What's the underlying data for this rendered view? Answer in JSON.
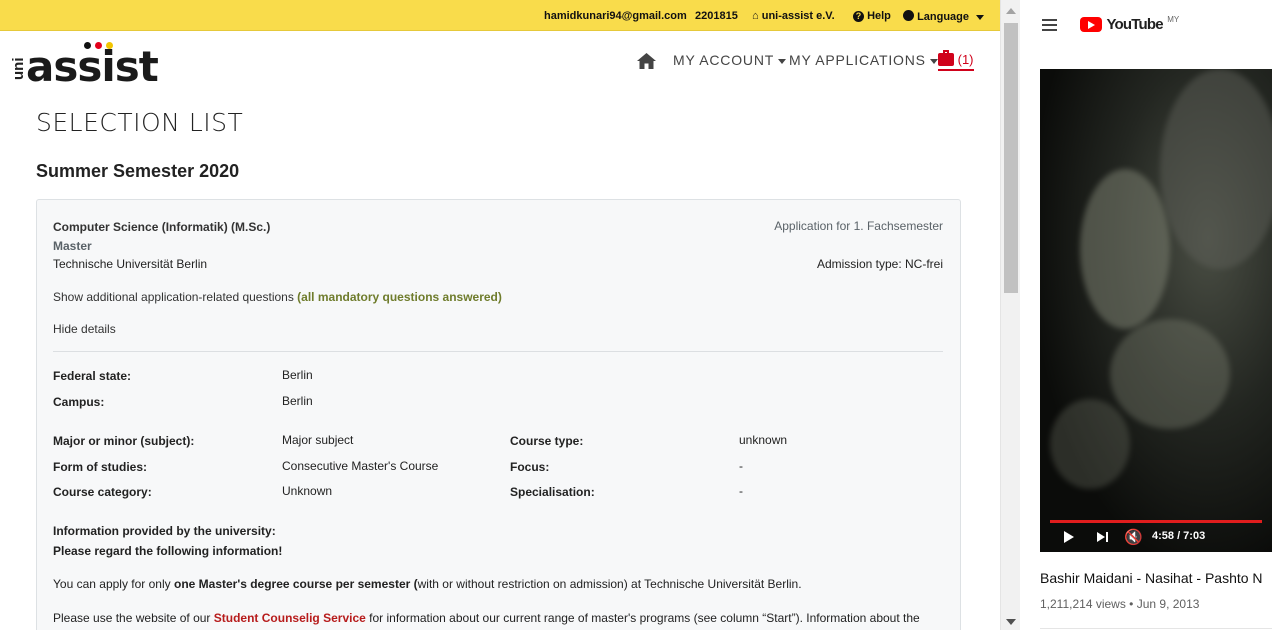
{
  "topbar": {
    "email": "hamidkunari94@gmail.com",
    "user_id": "2201815",
    "org_link": "uni-assist e.V.",
    "help": "Help",
    "language": "Language"
  },
  "logo": {
    "uni": "uni",
    "assist": "assist"
  },
  "nav": {
    "account": "MY ACCOUNT",
    "applications": "MY APPLICATIONS",
    "cart_count": "(1)"
  },
  "page": {
    "title": "SELECTION LIST",
    "semester": "Summer Semester 2020"
  },
  "application": {
    "course": "Computer Science (Informatik) (M.Sc.)",
    "degree": "Master",
    "university": "Technische Universität Berlin",
    "application_for": "Application for 1. Fachsemester",
    "admission_type": "Admission type: NC-frei",
    "additional_questions_link": "Show additional application-related questions",
    "additional_questions_status": "(all mandatory questions answered)",
    "hide_details": "Hide details",
    "details": {
      "federal_state_label": "Federal state:",
      "federal_state": "Berlin",
      "campus_label": "Campus:",
      "campus": "Berlin",
      "major_minor_label": "Major or minor (subject):",
      "major_minor": "Major subject",
      "course_type_label": "Course type:",
      "course_type": "unknown",
      "form_label": "Form of studies:",
      "form": "Consecutive Master's Course",
      "focus_label": "Focus:",
      "focus": "-",
      "category_label": "Course category:",
      "category": "Unknown",
      "specialisation_label": "Specialisation:",
      "specialisation": "-"
    },
    "info_heading_1": "Information provided by the university:",
    "info_heading_2": "Please regard the following information!",
    "info_p1_a": "You can apply for only ",
    "info_p1_b": "one Master's degree course per semester (",
    "info_p1_c": "with or without restriction on admission) at Technische Universität Berlin.",
    "info_p2_a": "Please use the website of our ",
    "info_p2_link": "Student Counselig Service",
    "info_p2_b": " for information about our current range of master's programs (see column “Start”). Information about the"
  },
  "youtube": {
    "brand": "YouTube",
    "region": "MY",
    "time": "4:58 / 7:03",
    "video_title": "Bashir Maidani - Nasihat - Pashto N",
    "views": "1,211,214 views",
    "date": "Jun 9, 2013",
    "progress": 0.707
  },
  "colors": {
    "topbar_bg": "#f9dc4b",
    "cart_red": "#d0021b",
    "green_status": "#6f7c2c",
    "link_red": "#b71c1c",
    "youtube_red": "#ff0000"
  }
}
